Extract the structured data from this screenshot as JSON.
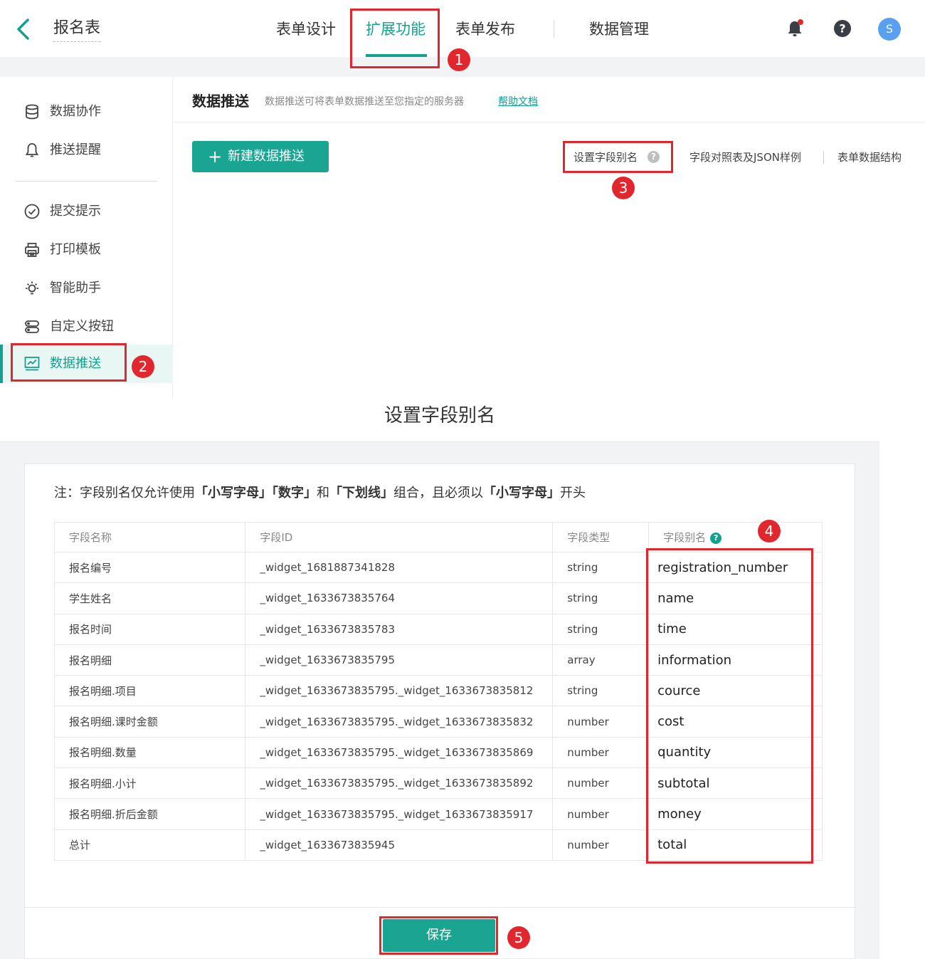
{
  "header": {
    "app_title": "报名表",
    "tabs": [
      {
        "label": "表单设计"
      },
      {
        "label": "扩展功能",
        "active": true
      },
      {
        "label": "表单发布"
      },
      {
        "label": "数据管理"
      }
    ],
    "avatar_letter": "S",
    "icons": [
      "back-arrow-icon",
      "bell-icon",
      "help-icon"
    ],
    "accent_color": "#14a08e",
    "notification_dot_color": "#e2262e"
  },
  "sidebar": {
    "items": [
      {
        "label": "数据协作",
        "icon": "database-icon"
      },
      {
        "label": "推送提醒",
        "icon": "bell-icon"
      },
      {
        "label": "提交提示",
        "icon": "check-circle-icon"
      },
      {
        "label": "打印模板",
        "icon": "printer-icon"
      },
      {
        "label": "智能助手",
        "icon": "bulb-icon"
      },
      {
        "label": "自定义按钮",
        "icon": "buttons-icon"
      },
      {
        "label": "数据推送",
        "icon": "chart-icon",
        "active": true
      }
    ]
  },
  "main": {
    "title": "数据推送",
    "description": "数据推送可将表单数据推送至您指定的服务器",
    "help_link": "帮助文档",
    "new_button": "新建数据推送",
    "links": {
      "alias": "设置字段别名",
      "json": "字段对照表及JSON样例",
      "structure": "表单数据结构"
    }
  },
  "modal": {
    "title": "设置字段别名",
    "note": {
      "prefix": "注：字段别名仅允许使用",
      "t1": "「小写字母」「数字」",
      "mid1": "和",
      "t2": "「下划线」",
      "mid2": "组合，且必须以",
      "t3": "「小写字母」",
      "suffix": "开头"
    },
    "columns": [
      "字段名称",
      "字段ID",
      "字段类型",
      "字段别名"
    ],
    "rows": [
      {
        "name": "报名编号",
        "id": "_widget_1681887341828",
        "type": "string",
        "alias": "registration_number"
      },
      {
        "name": "学生姓名",
        "id": "_widget_1633673835764",
        "type": "string",
        "alias": "name"
      },
      {
        "name": "报名时间",
        "id": "_widget_1633673835783",
        "type": "string",
        "alias": "time"
      },
      {
        "name": "报名明细",
        "id": "_widget_1633673835795",
        "type": "array",
        "alias": "information"
      },
      {
        "name": "报名明细.项目",
        "id": "_widget_1633673835795._widget_1633673835812",
        "type": "string",
        "alias": "cource"
      },
      {
        "name": "报名明细.课时金额",
        "id": "_widget_1633673835795._widget_1633673835832",
        "type": "number",
        "alias": "cost"
      },
      {
        "name": "报名明细.数量",
        "id": "_widget_1633673835795._widget_1633673835869",
        "type": "number",
        "alias": "quantity"
      },
      {
        "name": "报名明细.小计",
        "id": "_widget_1633673835795._widget_1633673835892",
        "type": "number",
        "alias": "subtotal"
      },
      {
        "name": "报名明细.折后金额",
        "id": "_widget_1633673835795._widget_1633673835917",
        "type": "number",
        "alias": "money"
      },
      {
        "name": "总计",
        "id": "_widget_1633673835945",
        "type": "number",
        "alias": "total"
      }
    ],
    "save_button": "保存"
  },
  "annotations": {
    "badges": [
      "1",
      "2",
      "3",
      "4",
      "5"
    ],
    "color": "#e2262e"
  }
}
